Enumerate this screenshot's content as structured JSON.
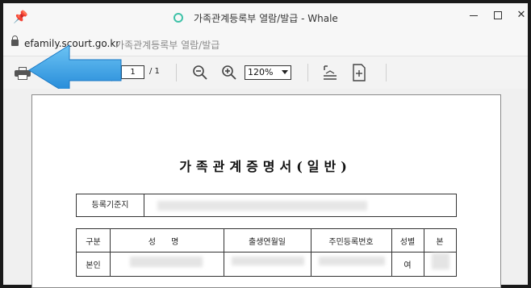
{
  "window": {
    "title": "가족관계등록부 열람/발급 - Whale",
    "controls": {
      "minimize": "",
      "maximize": "",
      "close": "✕"
    }
  },
  "address": {
    "domain": "efamily.scourt.go.kr",
    "page_title": "가족관계등록부 열람/발급"
  },
  "toolbar": {
    "current_page": "1",
    "total_pages": "/ 1",
    "zoom": "120%"
  },
  "document": {
    "title": "가족관계증명서(일반)",
    "registry_label": "등록기준지",
    "table_headers": [
      "구분",
      "성 명",
      "출생연월일",
      "주민등록번호",
      "성별",
      "본"
    ],
    "row": {
      "category": "본인",
      "gender": "여"
    }
  },
  "colors": {
    "accent_arrow": "#3aa0e8",
    "whale_ring": "#3fc2a8"
  }
}
